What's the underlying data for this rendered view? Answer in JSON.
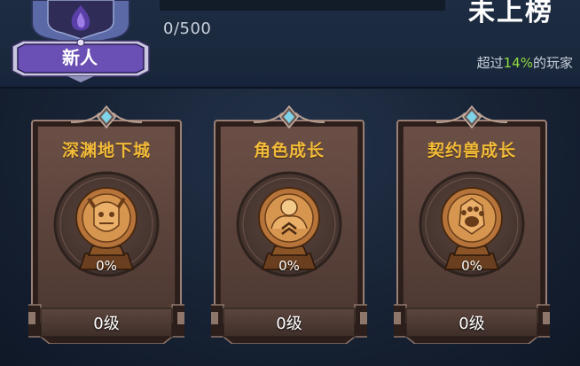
{
  "header": {
    "progress_text": "0/500",
    "progress_fraction": 0,
    "rank_title": "未上榜",
    "rank_desc_prefix": "超过",
    "rank_desc_percent": "14%",
    "rank_desc_suffix": "的玩家"
  },
  "badge": {
    "name": "新人",
    "icon": "flame-icon"
  },
  "cards": [
    {
      "title": "深渊地下城",
      "percent": "0%",
      "level": "0级",
      "icon": "dungeon-emblem-icon"
    },
    {
      "title": "角色成长",
      "percent": "0%",
      "level": "0级",
      "icon": "character-growth-emblem-icon"
    },
    {
      "title": "契约兽成长",
      "percent": "0%",
      "level": "0级",
      "icon": "pet-paw-emblem-icon"
    }
  ],
  "colors": {
    "title_gold": "#f2bb3a",
    "accent_green": "#8fdc3e",
    "frame_brown": "#5a4238"
  }
}
